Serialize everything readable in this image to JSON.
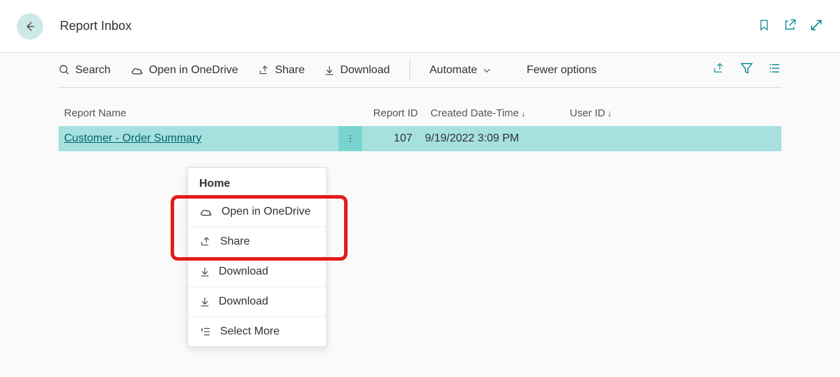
{
  "header": {
    "title": "Report Inbox"
  },
  "toolbar": {
    "search": "Search",
    "open_onedrive": "Open in OneDrive",
    "share": "Share",
    "download": "Download",
    "automate": "Automate",
    "fewer_options": "Fewer options"
  },
  "table": {
    "columns": {
      "name": "Report Name",
      "id": "Report ID",
      "date": "Created Date-Time",
      "user": "User ID"
    },
    "rows": [
      {
        "name": "Customer - Order Summary",
        "id": "107",
        "date": "9/19/2022 3:09 PM",
        "user": ""
      }
    ]
  },
  "context_menu": {
    "section": "Home",
    "items": {
      "open_onedrive": "Open in OneDrive",
      "share": "Share",
      "download1": "Download",
      "download2": "Download",
      "select_more": "Select More"
    }
  }
}
